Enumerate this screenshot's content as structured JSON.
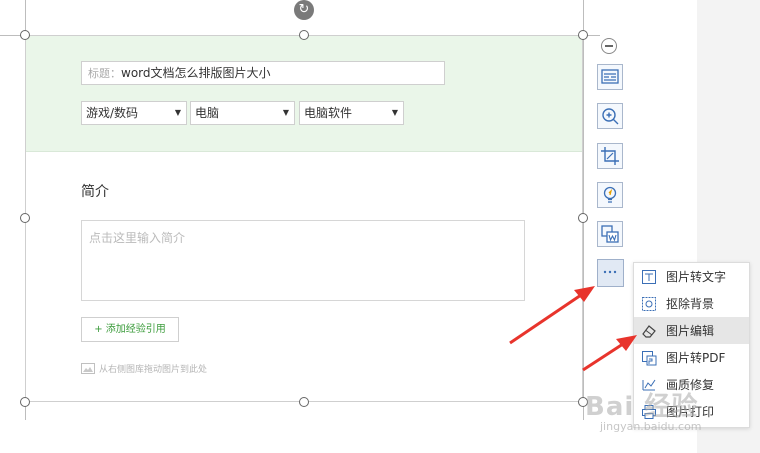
{
  "form": {
    "title_prefix": "标题：",
    "title_value": "word文档怎么排版图片大小",
    "categories": [
      "游戏/数码",
      "电脑",
      "电脑软件"
    ],
    "intro_heading": "简介",
    "intro_placeholder": "点击这里输入简介",
    "add_button": "+ 添加经验引用",
    "drag_hint": "从右侧图库拖动图片到此处"
  },
  "toolbar": {
    "icons": [
      "collapse-icon",
      "image-layout-icon",
      "zoom-in-icon",
      "crop-icon",
      "idea-icon",
      "image-to-word-icon",
      "more-icon"
    ]
  },
  "menu": {
    "items": [
      {
        "label": "图片转文字",
        "icon": "image-to-text-icon"
      },
      {
        "label": "抠除背景",
        "icon": "remove-background-icon"
      },
      {
        "label": "图片编辑",
        "icon": "eraser-icon"
      },
      {
        "label": "图片转PDF",
        "icon": "image-to-pdf-icon"
      },
      {
        "label": "画质修复",
        "icon": "quality-repair-icon"
      },
      {
        "label": "图片打印",
        "icon": "printer-icon"
      }
    ],
    "highlighted": "图片编辑"
  },
  "watermark": {
    "main": "Bai 经验",
    "sub": "jingyan.baidu.com"
  },
  "colors": {
    "green_band": "#eaf6e9",
    "arrow_red": "#e8342c",
    "link_green": "#3c9c3c",
    "toolbar_blue": "#3b6fb6"
  }
}
